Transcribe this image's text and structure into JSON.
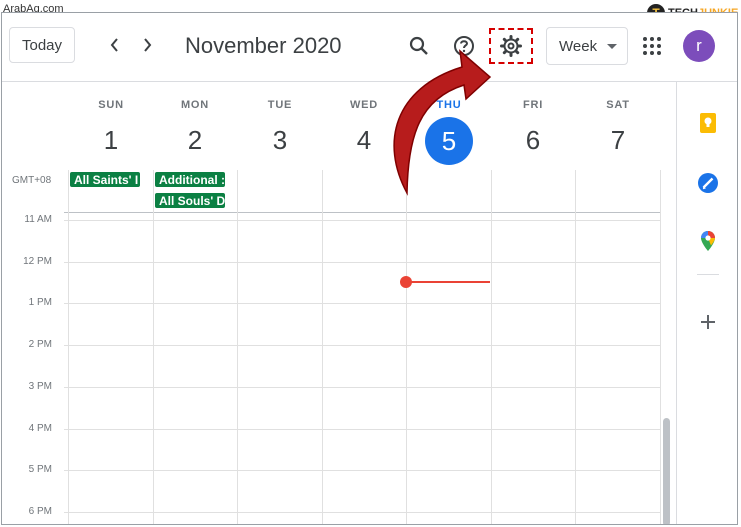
{
  "watermark": "ArabAq.com",
  "brand": {
    "initial": "T",
    "part1": "TECH",
    "part2": "JUNKIE"
  },
  "header": {
    "today_label": "Today",
    "title": "November 2020",
    "view_label": "Week",
    "avatar_letter": "r"
  },
  "days": [
    {
      "name": "SUN",
      "num": "1"
    },
    {
      "name": "MON",
      "num": "2"
    },
    {
      "name": "TUE",
      "num": "3"
    },
    {
      "name": "WED",
      "num": "4"
    },
    {
      "name": "THU",
      "num": "5"
    },
    {
      "name": "FRI",
      "num": "6"
    },
    {
      "name": "SAT",
      "num": "7"
    }
  ],
  "timezone": "GMT+08",
  "events": [
    {
      "label": "All Saints' I"
    },
    {
      "label": "Additional :"
    },
    {
      "label": "All Souls' D"
    }
  ],
  "hours": [
    "11 AM",
    "12 PM",
    "1 PM",
    "2 PM",
    "3 PM",
    "4 PM",
    "5 PM",
    "6 PM"
  ],
  "colors": {
    "today": "#1a73e8",
    "event": "#0b8043",
    "now": "#ea4335",
    "avatar": "#7c4dbb",
    "highlight": "#d50000",
    "arrow": "#b71c1c"
  }
}
